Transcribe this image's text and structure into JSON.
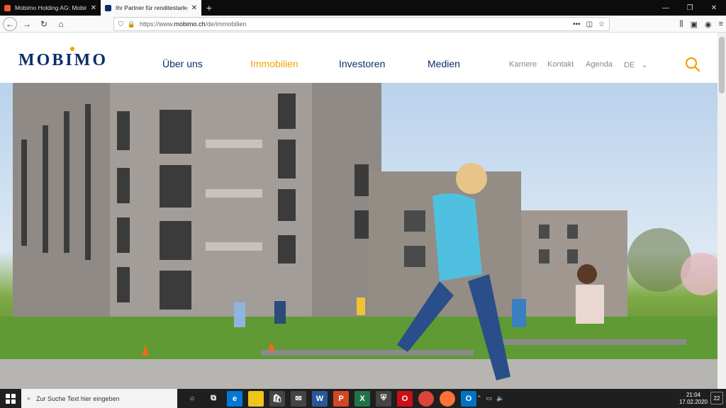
{
  "browser": {
    "tabs": [
      {
        "title": "Mobimo Holding AG: Mobimo",
        "close": "✕",
        "favicon_color": "#f15a22"
      },
      {
        "title": "Ihr Partner für renditestarke An",
        "close": "✕",
        "favicon_color": "#0c2d6b"
      }
    ],
    "newtab": "+",
    "window_controls": [
      "—",
      "❐",
      "✕"
    ],
    "url_prefix": "https://www.",
    "url_host": "mobimo.ch",
    "url_path": "/de/immobilien",
    "url_more": "•••"
  },
  "site": {
    "logo": "MOBIMO",
    "nav": [
      "Über uns",
      "Immobilien",
      "Investoren",
      "Medien"
    ],
    "secnav": [
      "Karriere",
      "Kontakt",
      "Agenda"
    ],
    "lang": "DE",
    "colors": {
      "brand": "#0c2d6b",
      "accent": "#f1a200"
    }
  },
  "taskbar": {
    "search_placeholder": "Zur Suche Text hier eingeben",
    "time": "21:04",
    "date": "17.02.2020",
    "notification_count": "22",
    "apps": [
      {
        "name": "edge",
        "color": "#0078d7",
        "label": "e"
      },
      {
        "name": "explorer",
        "color": "#f0c419",
        "label": ""
      },
      {
        "name": "store",
        "color": "#444",
        "label": ""
      },
      {
        "name": "mail",
        "color": "#444",
        "label": ""
      },
      {
        "name": "word",
        "color": "#2b579a",
        "label": "W"
      },
      {
        "name": "powerpoint",
        "color": "#d24726",
        "label": "P"
      },
      {
        "name": "excel",
        "color": "#217346",
        "label": "X"
      },
      {
        "name": "security",
        "color": "#444",
        "label": ""
      },
      {
        "name": "opera",
        "color": "#cc0f16",
        "label": "O"
      },
      {
        "name": "chrome",
        "color": "#db4437",
        "label": ""
      },
      {
        "name": "firefox",
        "color": "#ff7139",
        "label": ""
      },
      {
        "name": "outlook",
        "color": "#0072c6",
        "label": "O"
      }
    ]
  }
}
